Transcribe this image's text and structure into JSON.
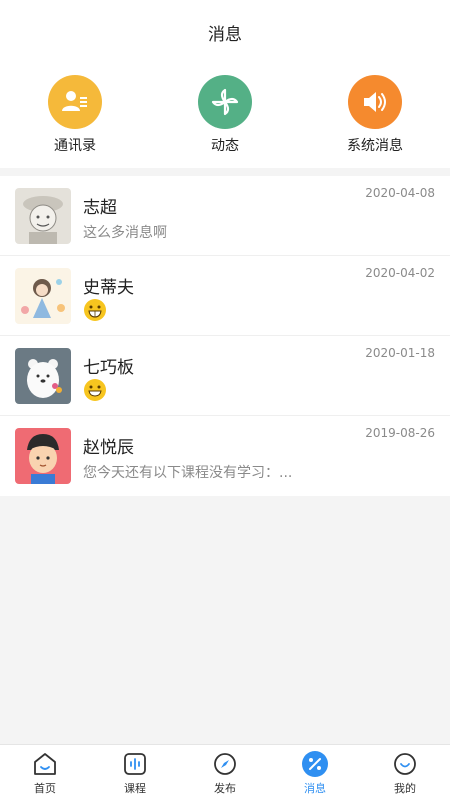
{
  "header": {
    "title": "消息"
  },
  "shortcuts": [
    {
      "label": "通讯录",
      "icon": "contacts-icon",
      "color": "#f5b93a"
    },
    {
      "label": "动态",
      "icon": "pinwheel-icon",
      "color": "#54b086"
    },
    {
      "label": "系统消息",
      "icon": "speaker-icon",
      "color": "#f58a2e"
    }
  ],
  "messages": [
    {
      "name": "志超",
      "preview": "这么多消息啊",
      "date": "2020-04-08",
      "avatar": "sketch-boy-avatar"
    },
    {
      "name": "史蒂夫",
      "preview": "",
      "date": "2020-04-02",
      "avatar": "illustrated-girl-avatar",
      "emoji": "grin-emoji-icon"
    },
    {
      "name": "七巧板",
      "preview": "",
      "date": "2020-01-18",
      "avatar": "white-bear-avatar",
      "emoji": "smile-emoji-icon"
    },
    {
      "name": "赵悦辰",
      "preview": "您今天还有以下课程没有学习：...",
      "date": "2019-08-26",
      "avatar": "cartoon-boy-avatar"
    }
  ],
  "tabbar": {
    "tabs": [
      {
        "label": "首页",
        "icon": "home-icon"
      },
      {
        "label": "课程",
        "icon": "course-icon"
      },
      {
        "label": "发布",
        "icon": "compass-icon"
      },
      {
        "label": "消息",
        "icon": "message-icon",
        "active": true
      },
      {
        "label": "我的",
        "icon": "profile-icon"
      }
    ]
  }
}
